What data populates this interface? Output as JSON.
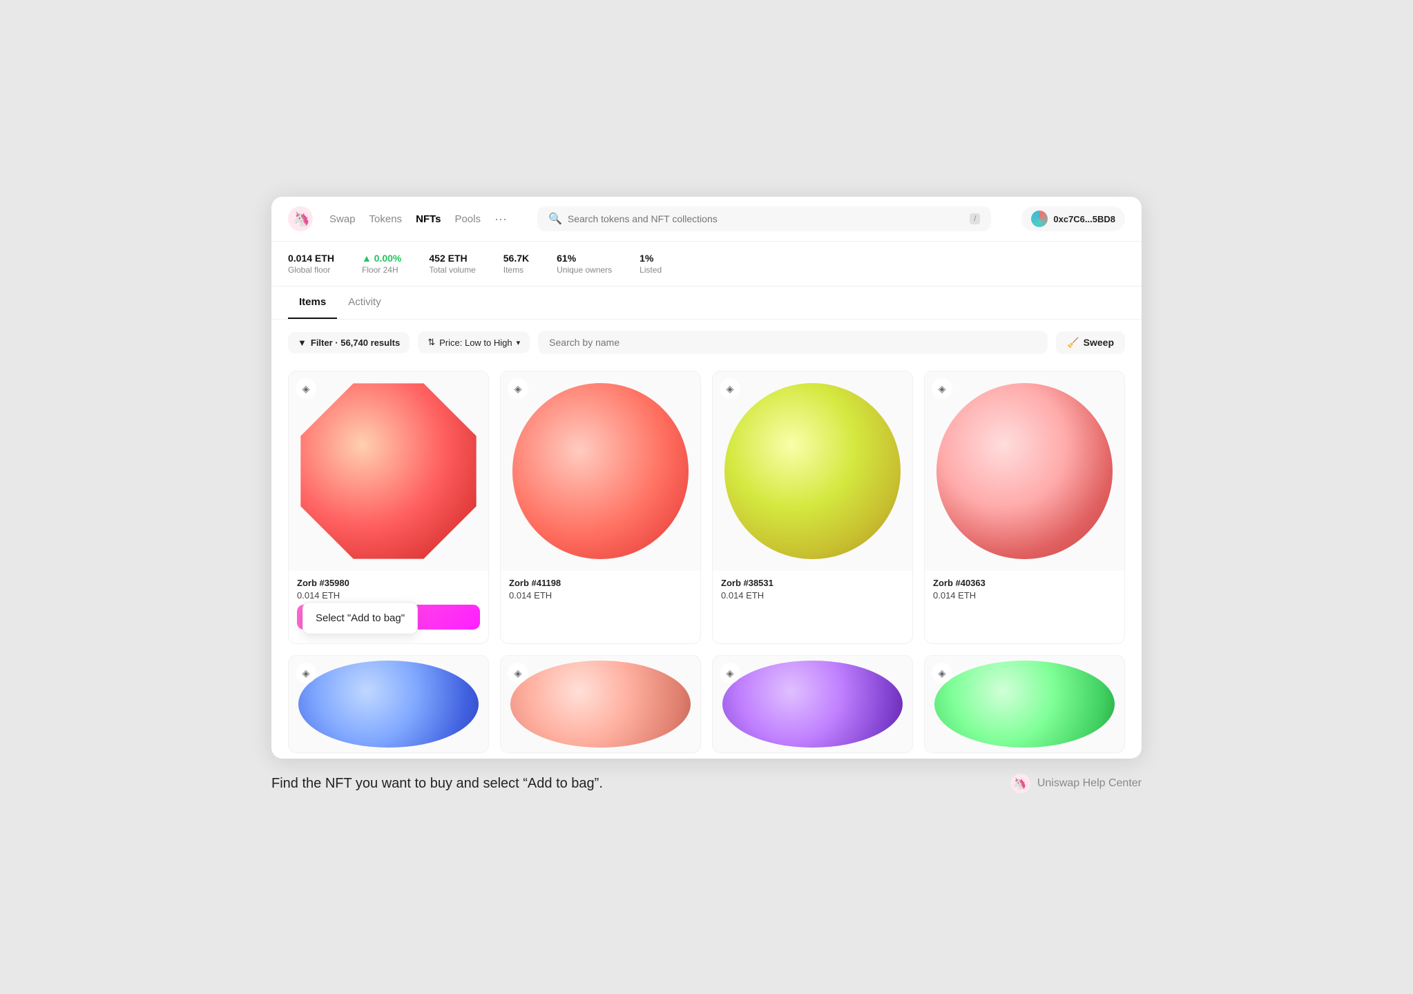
{
  "nav": {
    "swap_label": "Swap",
    "tokens_label": "Tokens",
    "nfts_label": "NFTs",
    "pools_label": "Pools",
    "more_label": "···",
    "search_placeholder": "Search tokens and NFT collections",
    "search_shortcut": "/",
    "wallet_address": "0xc7C6...5BD8"
  },
  "stats": [
    {
      "value": "0.014 ETH",
      "label": "Global floor"
    },
    {
      "value": "▲ 0.00%",
      "label": "Floor 24H",
      "positive": true
    },
    {
      "value": "452 ETH",
      "label": "Total volume"
    },
    {
      "value": "56.7K",
      "label": "Items"
    },
    {
      "value": "61%",
      "label": "Unique owners"
    },
    {
      "value": "1%",
      "label": "Listed"
    }
  ],
  "tabs": [
    {
      "label": "Items",
      "active": true
    },
    {
      "label": "Activity",
      "active": false
    }
  ],
  "filter_bar": {
    "filter_label": "Filter · 56,740 results",
    "sort_label": "Price: Low to High",
    "search_placeholder": "Search by name",
    "sweep_label": "Sweep"
  },
  "nfts_row1": [
    {
      "name": "Zorb #35980",
      "price": "0.014 ETH",
      "sphere_class": "sphere-red-warm",
      "shape_class": "shape-octagon",
      "show_add_to_bag": true,
      "add_to_bag_label": "Add to bag"
    },
    {
      "name": "Zorb #41198",
      "price": "0.014 ETH",
      "sphere_class": "sphere-red-soft",
      "shape_class": "",
      "show_add_to_bag": false
    },
    {
      "name": "Zorb #38531",
      "price": "0.014 ETH",
      "sphere_class": "sphere-yellow-green",
      "shape_class": "",
      "show_add_to_bag": false
    },
    {
      "name": "Zorb #40363",
      "price": "0.014 ETH",
      "sphere_class": "sphere-pink-red",
      "shape_class": "",
      "show_add_to_bag": false
    }
  ],
  "nfts_row2": [
    {
      "sphere_class": "sphere-blue"
    },
    {
      "sphere_class": "sphere-salmon"
    },
    {
      "sphere_class": "sphere-purple"
    },
    {
      "sphere_class": "sphere-green"
    }
  ],
  "tooltip": {
    "text": "Select \"Add to bag\""
  },
  "footer": {
    "text": "Find the NFT you want to buy and select “Add to bag”.",
    "brand": "Uniswap Help Center"
  }
}
